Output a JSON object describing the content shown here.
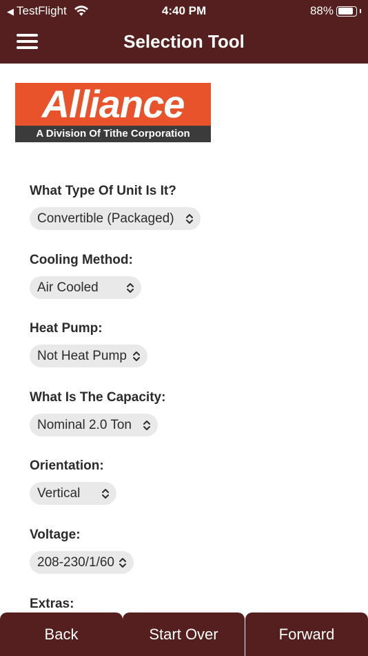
{
  "status_bar": {
    "back_app": "TestFlight",
    "time": "4:40 PM",
    "battery": "88%",
    "battery_level": 0.88
  },
  "header": {
    "title": "Selection Tool",
    "menu_icon": "hamburger-menu-icon"
  },
  "logo": {
    "brand": "Alliance",
    "tagline": "A Division Of Tithe Corporation"
  },
  "form": [
    {
      "label": "What Type Of Unit Is It?",
      "value": "Convertible (Packaged)"
    },
    {
      "label": "Cooling Method:",
      "value": "Air Cooled"
    },
    {
      "label": "Heat Pump:",
      "value": "Not Heat Pump"
    },
    {
      "label": "What Is The Capacity:",
      "value": "Nominal 2.0 Ton"
    },
    {
      "label": "Orientation:",
      "value": "Vertical"
    },
    {
      "label": "Voltage:",
      "value": "208-230/1/60"
    },
    {
      "label": "Extras:"
    }
  ],
  "footer": {
    "back": "Back",
    "start_over": "Start Over",
    "forward": "Forward"
  },
  "colors": {
    "brand_maroon": "#551f1f",
    "logo_orange": "#e8532b",
    "select_bg": "#e9e9e9"
  }
}
